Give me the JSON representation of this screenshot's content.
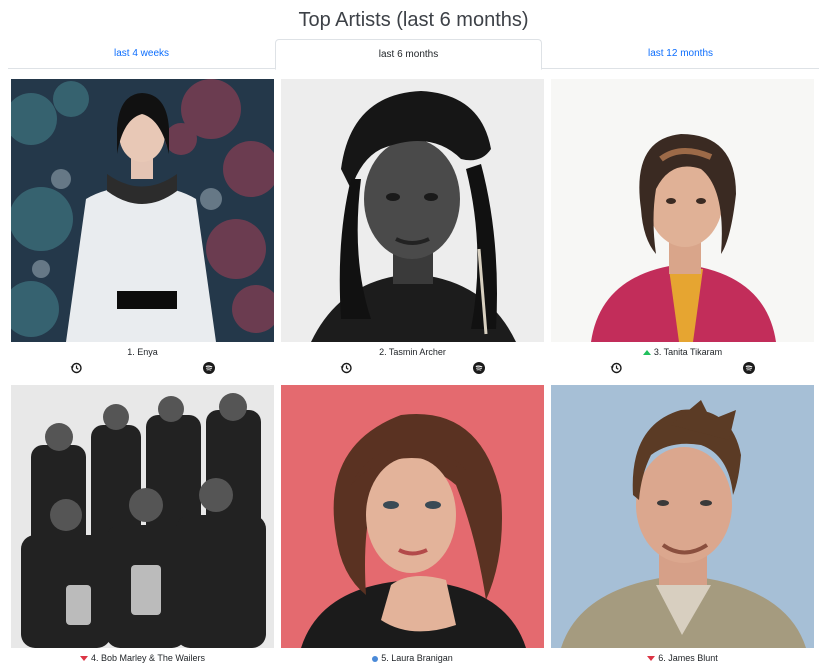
{
  "page": {
    "title": "Top Artists (last 6 months)"
  },
  "tabs": [
    {
      "label": "last 4 weeks",
      "active": false
    },
    {
      "label": "last 6 months",
      "active": true
    },
    {
      "label": "last 12 months",
      "active": false
    }
  ],
  "colors": {
    "link": "#0d6efd",
    "trend_up": "#20c05c",
    "trend_down": "#dc3545",
    "trend_new": "#4a8ad8"
  },
  "artists": [
    {
      "label": "1. Enya",
      "trend": "none",
      "photo": "enya-photo"
    },
    {
      "label": "2. Tasmin Archer",
      "trend": "none",
      "photo": "tasmin-archer-photo"
    },
    {
      "label": "3. Tanita Tikaram",
      "trend": "up",
      "photo": "tanita-tikaram-photo"
    },
    {
      "label": "4. Bob Marley & The Wailers",
      "trend": "down",
      "photo": "bob-marley-photo"
    },
    {
      "label": "5. Laura Branigan",
      "trend": "new",
      "photo": "laura-branigan-photo"
    },
    {
      "label": "6. James Blunt",
      "trend": "down",
      "photo": "james-blunt-photo"
    }
  ],
  "icons": {
    "history": "history-icon",
    "spotify": "spotify-icon"
  }
}
